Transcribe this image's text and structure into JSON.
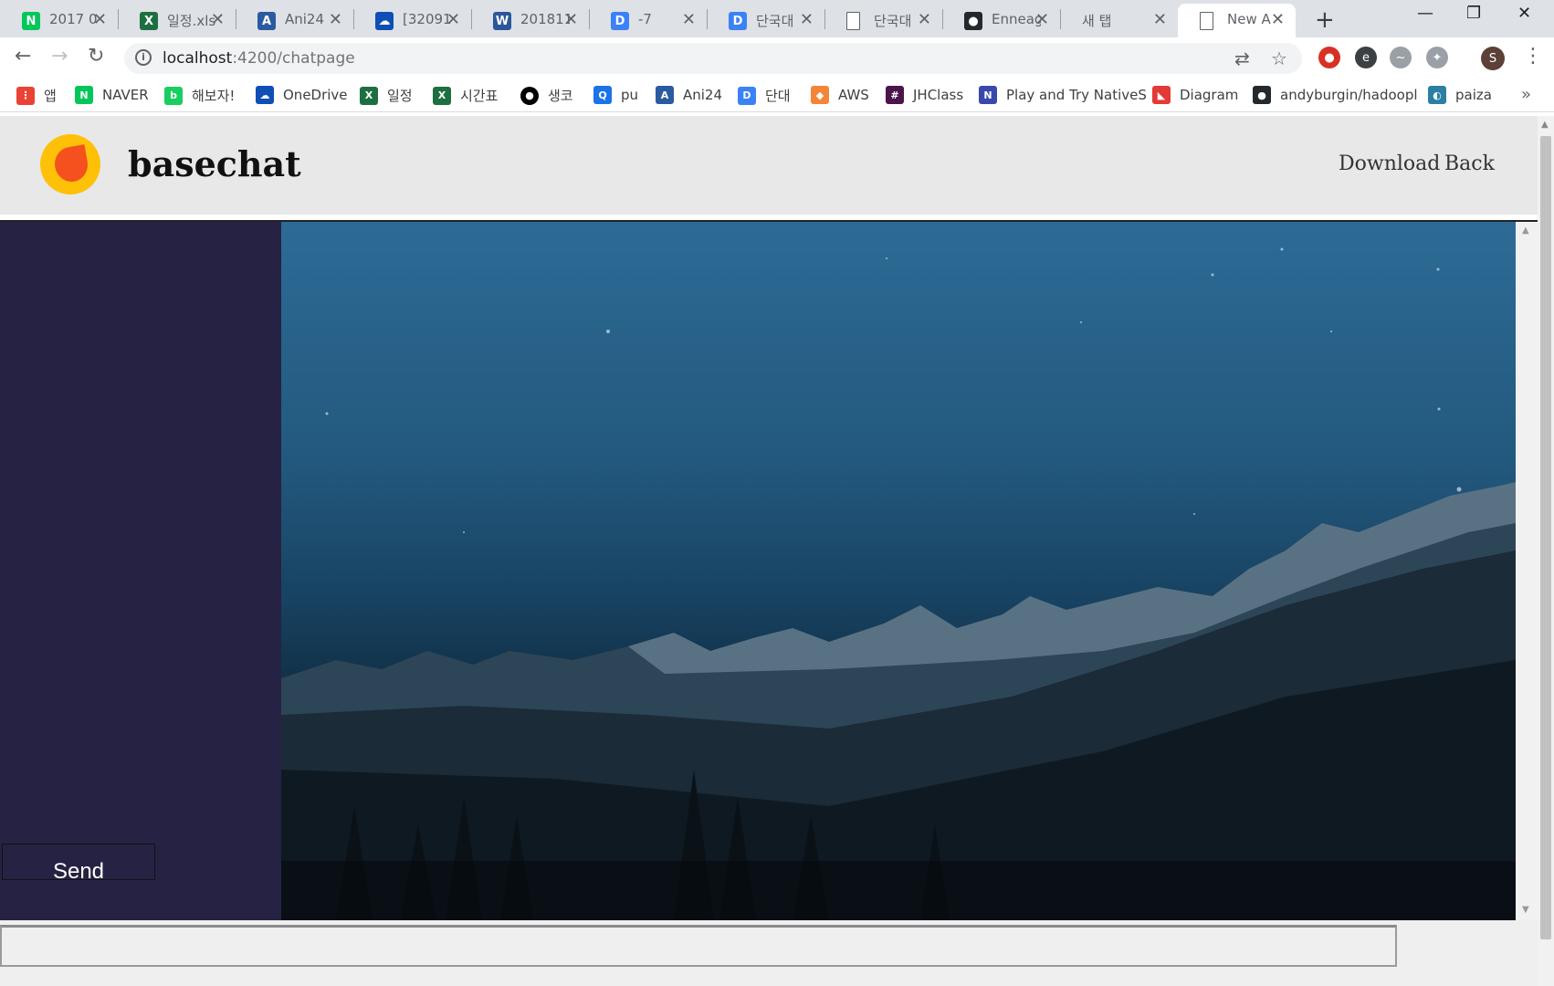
{
  "browser": {
    "tabs": [
      {
        "label": "2017 0",
        "favicon": "naver-icon",
        "color": "#03c75a",
        "glyph": "N"
      },
      {
        "label": "일정.xls",
        "favicon": "excel-icon",
        "color": "#1d6f42",
        "glyph": "X"
      },
      {
        "label": "Ani24",
        "favicon": "ani24-icon",
        "color": "#2c5aa0",
        "glyph": "A"
      },
      {
        "label": "[32091",
        "favicon": "onedrive-icon",
        "color": "#0f4fb5",
        "glyph": "☁"
      },
      {
        "label": "201811",
        "favicon": "word-icon",
        "color": "#2b579a",
        "glyph": "W"
      },
      {
        "label": "-7",
        "favicon": "d-icon",
        "color": "#3b82f6",
        "glyph": "D"
      },
      {
        "label": "단국대",
        "favicon": "d-icon",
        "color": "#3b82f6",
        "glyph": "D"
      },
      {
        "label": "단국대",
        "favicon": "page-icon",
        "color": "#ffffff",
        "glyph": ""
      },
      {
        "label": "Enneag",
        "favicon": "github-icon",
        "color": "#24292e",
        "glyph": "●"
      },
      {
        "label": "새 탭",
        "favicon": "none",
        "color": "",
        "glyph": ""
      },
      {
        "label": "New A",
        "favicon": "page-icon",
        "color": "#ffffff",
        "glyph": ""
      }
    ],
    "url_host": "localhost",
    "url_path": ":4200/chatpage",
    "profile_initial": "S",
    "bookmarks": [
      {
        "label": "앱",
        "color": "#ea4335",
        "glyph": "⋮"
      },
      {
        "label": "NAVER",
        "color": "#03c75a",
        "glyph": "N"
      },
      {
        "label": "해보자!",
        "color": "#19ce60",
        "glyph": "b"
      },
      {
        "label": "OneDrive",
        "color": "#0f4fb5",
        "glyph": "☁"
      },
      {
        "label": "일정",
        "color": "#1d6f42",
        "glyph": "X"
      },
      {
        "label": "시간표",
        "color": "#1d6f42",
        "glyph": "X"
      },
      {
        "label": "생코",
        "color": "#000000",
        "glyph": "●"
      },
      {
        "label": "pu",
        "color": "#1a73e8",
        "glyph": "Q"
      },
      {
        "label": "Ani24",
        "color": "#2c5aa0",
        "glyph": "A"
      },
      {
        "label": "단대",
        "color": "#3b82f6",
        "glyph": "D"
      },
      {
        "label": "AWS",
        "color": "#f58536",
        "glyph": "◆"
      },
      {
        "label": "JHClass",
        "color": "#4a154b",
        "glyph": "#"
      },
      {
        "label": "Play and Try NativeS",
        "color": "#3949ab",
        "glyph": "N"
      },
      {
        "label": "Diagram",
        "color": "#e53935",
        "glyph": "◣"
      },
      {
        "label": "andyburgin/hadoopl",
        "color": "#24292e",
        "glyph": "●"
      },
      {
        "label": "paiza",
        "color": "#2a7fa3",
        "glyph": "◐"
      }
    ]
  },
  "app": {
    "brand": "basechat",
    "nav": {
      "download": "Download",
      "back": "Back"
    },
    "message_input": {
      "value": "",
      "placeholder": ""
    },
    "send_label": "Send"
  },
  "colors": {
    "sidebar": "#262244",
    "header": "#e8e8e8",
    "send_button": "#262244"
  }
}
